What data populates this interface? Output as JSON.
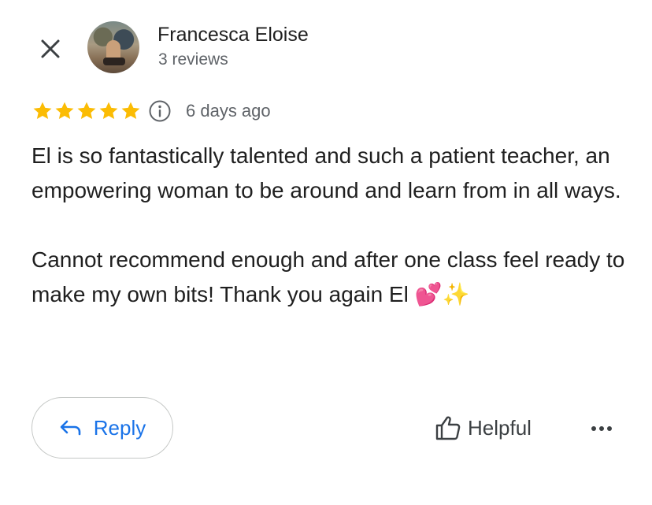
{
  "review": {
    "author_name": "Francesca Eloise",
    "author_meta": "3 reviews",
    "rating": 5,
    "rating_max": 5,
    "date": "6 days ago",
    "text": "El is so fantastically talented and such a patient teacher, an empowering woman to be around and learn from in all ways.\n\nCannot recommend enough and after one class feel ready to make my own bits! Thank you again El 💕✨"
  },
  "actions": {
    "reply_label": "Reply",
    "helpful_label": "Helpful"
  },
  "icons": {
    "close": "close-icon",
    "info": "info-icon",
    "reply": "reply-arrow-icon",
    "helpful": "thumbs-up-icon",
    "more": "more-horizontal-icon",
    "star": "star-icon"
  },
  "colors": {
    "star": "#fbbc04",
    "link": "#1a73e8",
    "secondary_text": "#5f6368",
    "border": "#c4c7c5"
  }
}
